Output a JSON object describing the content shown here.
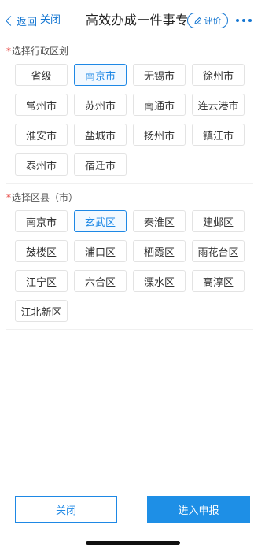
{
  "nav": {
    "back_label": "返回",
    "close_label": "关闭",
    "title": "高效办成一件事专",
    "rate_label": "评价"
  },
  "region_section": {
    "label": "选择行政区划",
    "required_mark": "*",
    "options": [
      "省级",
      "南京市",
      "无锡市",
      "徐州市",
      "常州市",
      "苏州市",
      "南通市",
      "连云港市",
      "淮安市",
      "盐城市",
      "扬州市",
      "镇江市",
      "泰州市",
      "宿迁市"
    ],
    "selected": "南京市"
  },
  "district_section": {
    "label": "选择区县（市）",
    "required_mark": "*",
    "options": [
      "南京市",
      "玄武区",
      "秦淮区",
      "建邺区",
      "鼓楼区",
      "浦口区",
      "栖霞区",
      "雨花台区",
      "江宁区",
      "六合区",
      "溧水区",
      "高淳区",
      "江北新区"
    ],
    "selected": "玄武区"
  },
  "footer": {
    "close_label": "关闭",
    "submit_label": "进入申报"
  },
  "colors": {
    "accent": "#1e88e5",
    "required": "#e53935"
  }
}
